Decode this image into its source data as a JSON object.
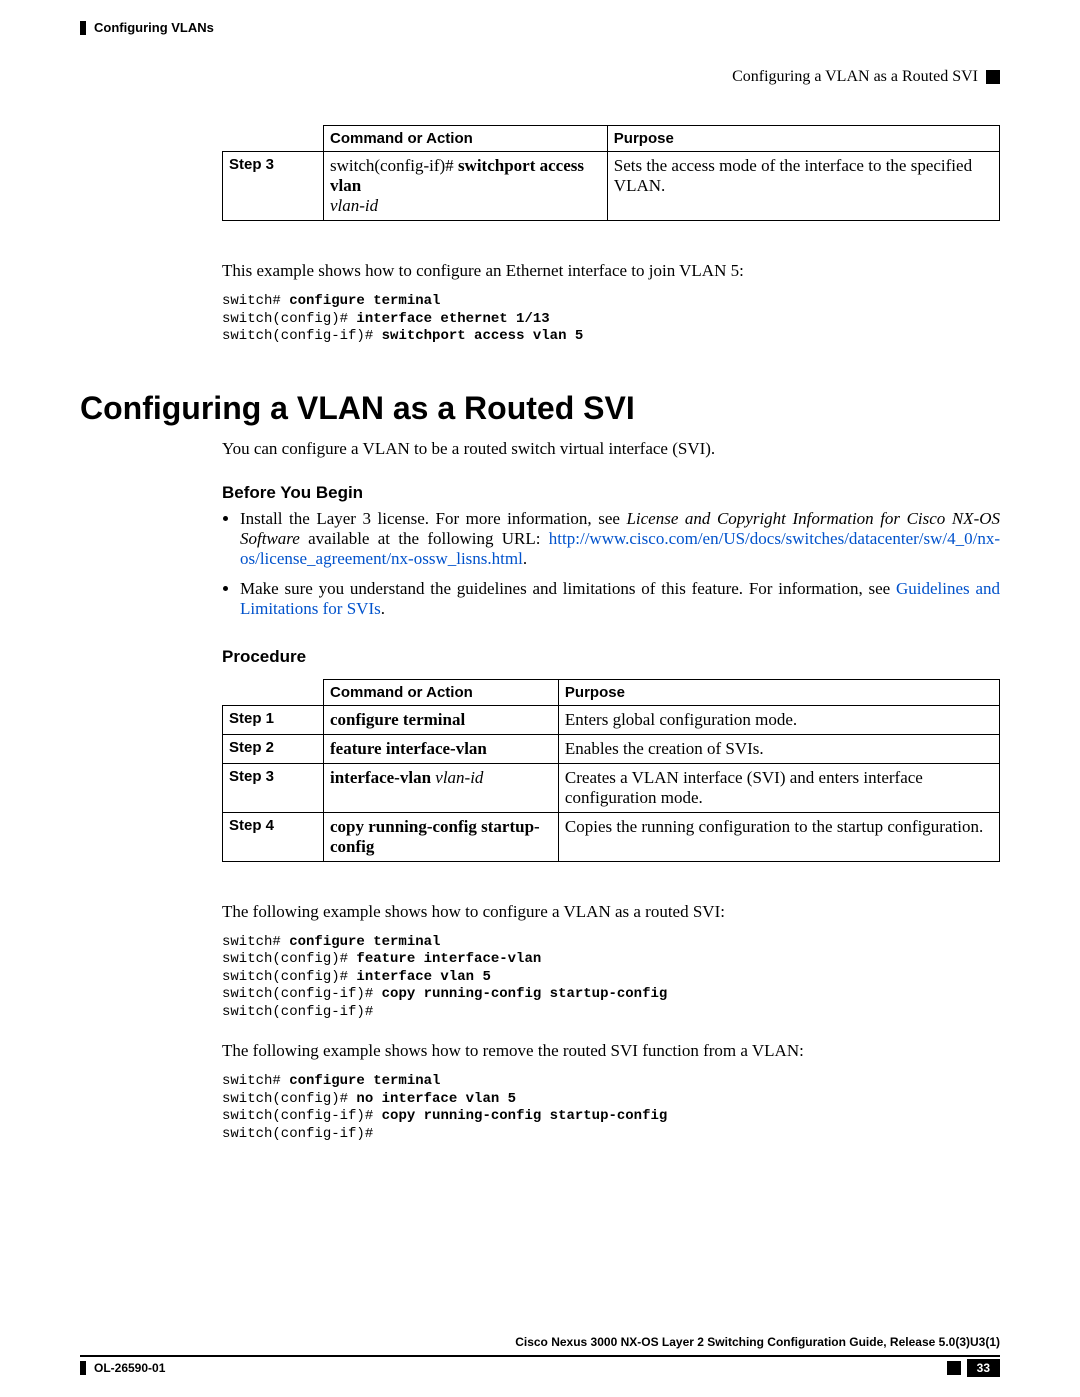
{
  "header": {
    "left_label": "Configuring VLANs",
    "right_label": "Configuring a VLAN as a Routed SVI"
  },
  "table1": {
    "th_action": "Command or Action",
    "th_purpose": "Purpose",
    "rows": [
      {
        "step": "Step 3",
        "action_prefix": "switch(config-if)# ",
        "action_bold": "switchport access vlan",
        "action_italic": " vlan-id",
        "purpose": "Sets the access mode of the interface to the specified VLAN."
      }
    ]
  },
  "example1_intro": "This example shows how to configure an Ethernet interface to join VLAN 5:",
  "code1": {
    "l1a": "switch# ",
    "l1b": "configure terminal",
    "l2a": "switch(config)# ",
    "l2b": "interface ethernet 1/13",
    "l3a": "switch(config-if)# ",
    "l3b": "switchport access vlan 5"
  },
  "section_title": "Configuring a VLAN as a Routed SVI",
  "section_intro": "You can configure a VLAN to be a routed switch virtual interface (SVI).",
  "before_heading": "Before You Begin",
  "bullets": {
    "b1a": "Install the Layer 3 license. For more information, see ",
    "b1b": "License and Copyright Information for Cisco NX-OS Software",
    "b1c": " available at the following URL: ",
    "b1d": "http://www.cisco.com/en/US/docs/switches/datacenter/sw/4_0/nx-os/license_agreement/nx-ossw_lisns.html",
    "b1e": ".",
    "b2a": "Make sure you understand the guidelines and limitations of this feature. For information, see ",
    "b2b": "Guidelines and Limitations for SVIs",
    "b2c": "."
  },
  "procedure_heading": "Procedure",
  "table2": {
    "th_action": "Command or Action",
    "th_purpose": "Purpose",
    "rows": [
      {
        "step": "Step 1",
        "action_bold": "configure terminal",
        "action_italic": "",
        "purpose": "Enters global configuration mode."
      },
      {
        "step": "Step 2",
        "action_bold": "feature interface-vlan",
        "action_italic": "",
        "purpose": "Enables the creation of SVIs."
      },
      {
        "step": "Step 3",
        "action_bold": "interface-vlan",
        "action_italic": " vlan-id",
        "purpose": "Creates a VLAN interface (SVI) and enters interface configuration mode."
      },
      {
        "step": "Step 4",
        "action_bold": "copy running-config startup-config",
        "action_italic": "",
        "purpose": "Copies the running configuration to the startup configuration."
      }
    ]
  },
  "example2_intro": "The following example shows how to configure a VLAN as a routed SVI:",
  "code2": {
    "l1a": "switch# ",
    "l1b": "configure terminal",
    "l2a": "switch(config)# ",
    "l2b": "feature interface-vlan",
    "l3a": "switch(config)# ",
    "l3b": "interface vlan 5",
    "l4a": "switch(config-if)# ",
    "l4b": "copy running-config startup-config",
    "l5a": "switch(config-if)#"
  },
  "example3_intro": "The following example shows how to remove the routed SVI function from a VLAN:",
  "code3": {
    "l1a": "switch# ",
    "l1b": "configure terminal",
    "l2a": "switch(config)# ",
    "l2b": "no interface vlan 5",
    "l3a": "switch(config-if)# ",
    "l3b": "copy running-config startup-config",
    "l4a": "switch(config-if)#"
  },
  "footer": {
    "guide_title": "Cisco Nexus 3000 NX-OS Layer 2 Switching Configuration Guide, Release 5.0(3)U3(1)",
    "doc_id": "OL-26590-01",
    "page_num": "33"
  }
}
